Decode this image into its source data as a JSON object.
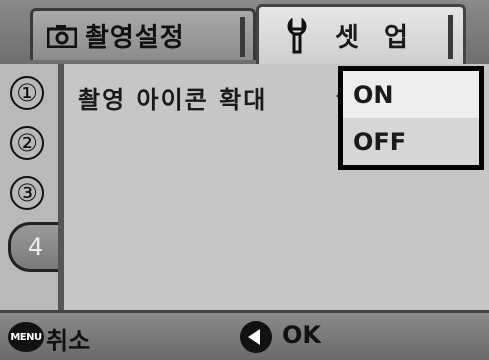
{
  "tabs": [
    {
      "label": "촬영설정",
      "icon": "camera-icon",
      "active": false
    },
    {
      "label": "셋 업",
      "icon": "wrench-icon",
      "active": true
    }
  ],
  "sidebar": {
    "pages": [
      "①",
      "②",
      "③",
      "4"
    ],
    "active_page": "4"
  },
  "main": {
    "setting_label": "촬영 아이콘 확대"
  },
  "dropdown": {
    "options": [
      "ON",
      "OFF"
    ],
    "highlighted": "ON"
  },
  "footer": {
    "menu_badge": "MENU",
    "cancel_label": "취소",
    "ok_label": "OK"
  },
  "colors": {
    "background": "#b9b9b9",
    "active_tab": "#dcdcdc",
    "dropdown_border": "#000000"
  }
}
